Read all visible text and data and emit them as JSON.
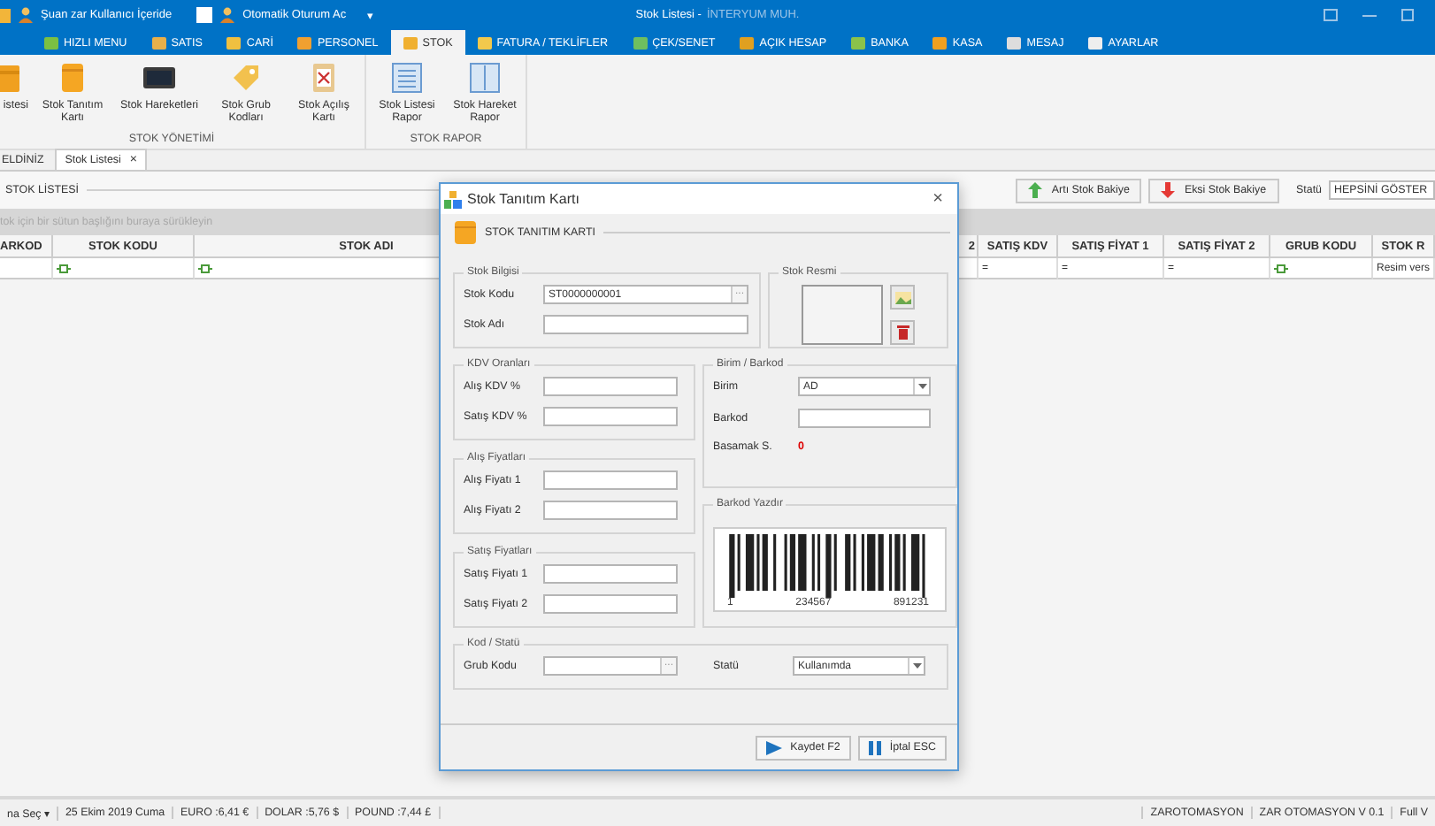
{
  "window": {
    "title": "Stok Listesi -",
    "subtitle": "İNTERYUM MUH."
  },
  "quick_bar": {
    "user_status": "Şuan zar Kullanıcı İçeride",
    "auto_login": {
      "label": "Otomatik Oturum Ac",
      "checked": false
    },
    "dropdown": "▾"
  },
  "menu_tabs": [
    {
      "label": "HIZLI MENU",
      "selected": false
    },
    {
      "label": "SATIS",
      "selected": false
    },
    {
      "label": "CARİ",
      "selected": false
    },
    {
      "label": "PERSONEL",
      "selected": false
    },
    {
      "label": "STOK",
      "selected": true
    },
    {
      "label": "FATURA / TEKLİFLER",
      "selected": false
    },
    {
      "label": "ÇEK/SENET",
      "selected": false
    },
    {
      "label": "AÇIK HESAP",
      "selected": false
    },
    {
      "label": "BANKA",
      "selected": false
    },
    {
      "label": "KASA",
      "selected": false
    },
    {
      "label": "MESAJ",
      "selected": false
    },
    {
      "label": "AYARLAR",
      "selected": false
    }
  ],
  "ribbon": {
    "groups": [
      {
        "label": "STOK YÖNETİMİ",
        "items": [
          {
            "label": "istesi",
            "kind": "folder"
          },
          {
            "label": "Stok Tanıtım Kartı",
            "kind": "card"
          },
          {
            "label": "Stok Hareketleri",
            "kind": "monitor"
          },
          {
            "label": "Stok Grub Kodları",
            "kind": "tag"
          },
          {
            "label": "Stok Açılış Kartı",
            "kind": "clipboard"
          }
        ]
      },
      {
        "label": "STOK RAPOR",
        "items": [
          {
            "label": "Stok Listesi Rapor",
            "kind": "list"
          },
          {
            "label": "Stok Hareket Rapor",
            "kind": "columns"
          }
        ]
      }
    ]
  },
  "doc_tabs": [
    {
      "label": "ELDİNİZ",
      "selected": false
    },
    {
      "label": "Stok Listesi",
      "selected": true,
      "close": "×"
    }
  ],
  "list_toolbar": {
    "title": "STOK LİSTESİ",
    "buttons": [
      {
        "label": "Artı Stok Bakiye",
        "kind": "up"
      },
      {
        "label": "Eksi Stok Bakiye",
        "kind": "down"
      }
    ],
    "status_label": "Statü",
    "status_value": "HEPSİNİ GÖSTER"
  },
  "group_panel_hint": "tok için bir sütun başlığını buraya sürükleyin",
  "table": {
    "columns": [
      "ARKOD",
      "STOK KODU",
      "STOK ADI",
      "2",
      "SATIŞ KDV",
      "SATIŞ FİYAT 1",
      "SATIŞ FİYAT 2",
      "GRUB KODU",
      "STOK R"
    ],
    "rows": [
      {
        "cells": [
          {
            "kind": "empty"
          },
          {
            "kind": "icon"
          },
          {
            "kind": "icon"
          },
          {
            "kind": "empty"
          },
          {
            "kind": "text",
            "text": "="
          },
          {
            "kind": "text",
            "text": "="
          },
          {
            "kind": "text",
            "text": "="
          },
          {
            "kind": "icon"
          },
          {
            "kind": "text",
            "text": "Resim vers"
          }
        ]
      }
    ]
  },
  "dialog": {
    "title": "Stok Tanıtım Kartı",
    "close": "×",
    "header": "STOK TANITIM KARTI",
    "stock_info": {
      "legend": "Stok Bilgisi",
      "fields": [
        {
          "label": "Stok Kodu",
          "kind": "lookup",
          "value": "ST0000000001",
          "button": "···"
        },
        {
          "label": "Stok Adı",
          "kind": "text"
        }
      ]
    },
    "stock_image": {
      "legend": "Stok Resmi"
    },
    "vat_rates": {
      "legend": "KDV Oranları",
      "fields": [
        {
          "label": "Alış KDV %",
          "kind": "text"
        },
        {
          "label": "Satış KDV %",
          "kind": "text"
        }
      ]
    },
    "purchase_prices": {
      "legend": "Alış Fiyatları",
      "fields": [
        {
          "label": "Alış Fiyatı 1",
          "kind": "text"
        },
        {
          "label": "Alış Fiyatı 2",
          "kind": "text"
        }
      ]
    },
    "sale_prices": {
      "legend": "Satış Fiyatları",
      "fields": [
        {
          "label": "Satış Fiyatı 1",
          "kind": "text"
        },
        {
          "label": "Satış Fiyatı 2",
          "kind": "text"
        }
      ]
    },
    "unit_barcode": {
      "legend": "Birim / Barkod",
      "fields": [
        {
          "label": "Birim",
          "kind": "select",
          "value": "AD"
        },
        {
          "label": "Barkod",
          "kind": "text"
        },
        {
          "label": "Basamak S.",
          "kind": "value",
          "value": "0"
        }
      ]
    },
    "barcode_print": {
      "legend": "Barkod Yazdır",
      "digits": [
        "1",
        "234567",
        "891231"
      ]
    },
    "code_status": {
      "legend": "Kod / Statü",
      "fields": [
        {
          "label": "Grub Kodu",
          "kind": "lookup",
          "button": "···"
        },
        {
          "label": "Statü",
          "kind": "select",
          "value": "Kullanımda"
        }
      ]
    },
    "buttons": [
      {
        "label": "Kaydet F2",
        "kind": "save"
      },
      {
        "label": "İptal ESC",
        "kind": "cancel"
      }
    ]
  },
  "status_bar": {
    "left": [
      "na Seç ▾",
      "25 Ekim 2019 Cuma",
      "EURO :6,41 €",
      "DOLAR :5,76 $",
      "POUND :7,44 £"
    ],
    "right": [
      "ZAROTOMASYON",
      "ZAR OTOMASYON V 0.1",
      "Full V"
    ]
  }
}
